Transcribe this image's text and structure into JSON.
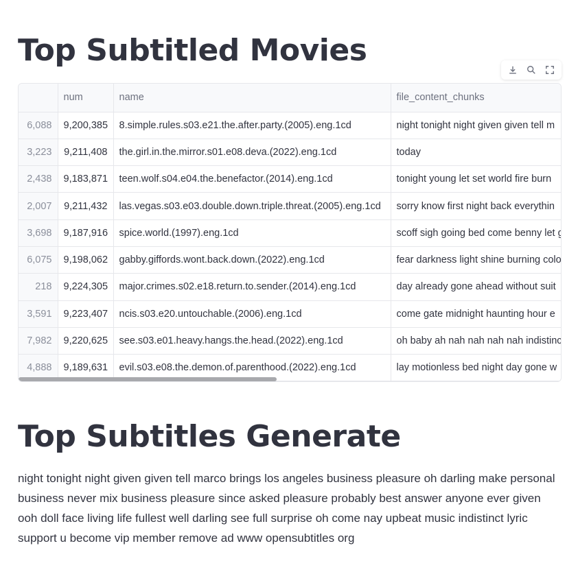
{
  "sections": {
    "movies_title": "Top Subtitled Movies",
    "generate_title": "Top Subtitles Generate"
  },
  "toolbar": {
    "download_icon": "download-icon",
    "search_icon": "search-icon",
    "fullscreen_icon": "fullscreen-icon"
  },
  "table": {
    "columns": [
      "",
      "num",
      "name",
      "file_content_chunks"
    ],
    "rows": [
      {
        "index": "6,088",
        "num": "9,200,385",
        "name": "8.simple.rules.s03.e21.the.after.party.(2005).eng.1cd",
        "chunks": "night tonight night given given tell m"
      },
      {
        "index": "3,223",
        "num": "9,211,408",
        "name": "the.girl.in.the.mirror.s01.e08.deva.(2022).eng.1cd",
        "chunks": "today"
      },
      {
        "index": "2,438",
        "num": "9,183,871",
        "name": "teen.wolf.s04.e04.the.benefactor.(2014).eng.1cd",
        "chunks": "tonight young let set world fire burn"
      },
      {
        "index": "2,007",
        "num": "9,211,432",
        "name": "las.vegas.s03.e03.double.down.triple.threat.(2005).eng.1cd",
        "chunks": "sorry know first night back everythin"
      },
      {
        "index": "3,698",
        "num": "9,187,916",
        "name": "spice.world.(1997).eng.1cd",
        "chunks": "scoff sigh going bed come benny let g"
      },
      {
        "index": "6,075",
        "num": "9,198,062",
        "name": "gabby.giffords.wont.back.down.(2022).eng.1cd",
        "chunks": "fear darkness light shine burning colo"
      },
      {
        "index": "218",
        "num": "9,224,305",
        "name": "major.crimes.s02.e18.return.to.sender.(2014).eng.1cd",
        "chunks": "day already gone ahead without suit"
      },
      {
        "index": "3,591",
        "num": "9,223,407",
        "name": "ncis.s03.e20.untouchable.(2006).eng.1cd",
        "chunks": "come gate midnight haunting hour e"
      },
      {
        "index": "7,982",
        "num": "9,220,625",
        "name": "see.s03.e01.heavy.hangs.the.head.(2022).eng.1cd",
        "chunks": "oh baby ah nah nah nah nah indistinc"
      },
      {
        "index": "4,888",
        "num": "9,189,631",
        "name": "evil.s03.e08.the.demon.of.parenthood.(2022).eng.1cd",
        "chunks": "lay motionless bed night day gone w"
      }
    ]
  },
  "generated_text": "night tonight night given given tell marco brings los angeles business pleasure oh darling make personal business never mix business pleasure since asked pleasure probably best answer anyone ever given ooh doll face living life fullest well darling see full surprise oh come nay upbeat music indistinct lyric support u become vip member remove ad www opensubtitles org"
}
